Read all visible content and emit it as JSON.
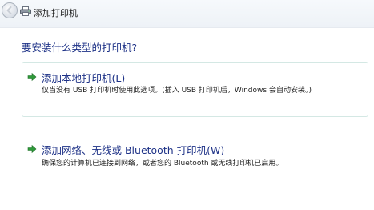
{
  "window": {
    "title": "添加打印机"
  },
  "question": "要安装什么类型的打印机?",
  "options": [
    {
      "title": "添加本地打印机(L)",
      "description": "仅当没有 USB 打印机时使用此选项。(插入 USB 打印机后，Windows 会自动安装。)"
    },
    {
      "title": "添加网络、无线或 Bluetooth 打印机(W)",
      "description": "确保您的计算机已连接到网络，或者您的 Bluetooth 或无线打印机已启用。"
    }
  ],
  "icons": {
    "back": "back-arrow-icon",
    "printer": "printer-icon",
    "option_arrow": "green-arrow-icon"
  },
  "colors": {
    "link_blue": "#1e3287",
    "arrow_green": "#2f9a3a",
    "selected_border": "#d4e8e4"
  }
}
